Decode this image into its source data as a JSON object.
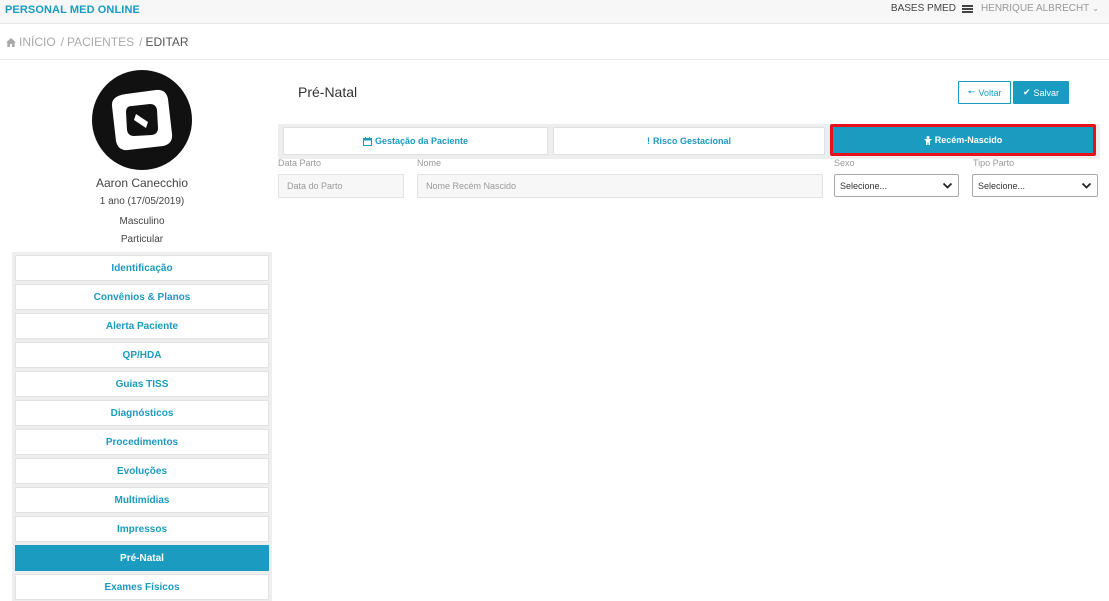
{
  "header": {
    "brand": "PERSONAL MED ONLINE",
    "bases": "BASES PMED",
    "user": "HENRIQUE ALBRECHT"
  },
  "breadcrumb": {
    "home": "INÍCIO",
    "pacientes": "PACIENTES",
    "current": "EDITAR"
  },
  "patient": {
    "name": "Aaron Canecchio",
    "age": "1 ano (17/05/2019)",
    "sex": "Masculino",
    "plan": "Particular"
  },
  "sidebar": {
    "items": [
      {
        "label": "Identificação"
      },
      {
        "label": "Convênios & Planos"
      },
      {
        "label": "Alerta Paciente"
      },
      {
        "label": "QP/HDA"
      },
      {
        "label": "Guias TISS"
      },
      {
        "label": "Diagnósticos"
      },
      {
        "label": "Procedimentos"
      },
      {
        "label": "Evoluções"
      },
      {
        "label": "Multimídias"
      },
      {
        "label": "Impressos"
      },
      {
        "label": "Pré-Natal"
      },
      {
        "label": "Exames Físicos"
      }
    ],
    "active_index": 10
  },
  "main": {
    "title": "Pré-Natal",
    "back_label": "Voltar",
    "save_label": "Salvar",
    "tabs": [
      {
        "label": "Gestação da Paciente",
        "icon": "calendar-icon"
      },
      {
        "label": "Risco Gestacional",
        "icon": "exclamation-icon"
      },
      {
        "label": "Recém-Nascido",
        "icon": "child-icon"
      }
    ]
  },
  "form": {
    "data_parto_label": "Data Parto",
    "data_parto_placeholder": "Data do Parto",
    "nome_label": "Nome",
    "nome_placeholder": "Nome Recém Nascido",
    "sexo_label": "Sexo",
    "sexo_value": "Selecione...",
    "tipo_parto_label": "Tipo Parto",
    "tipo_parto_value": "Selecione..."
  },
  "colors": {
    "accent": "#1a9bbf",
    "highlight": "#e8101a"
  }
}
